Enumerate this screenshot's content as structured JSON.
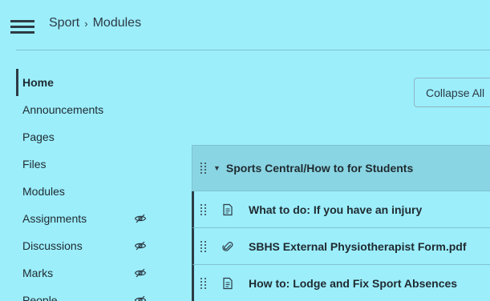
{
  "header": {
    "course": "Sport",
    "separator": "›",
    "page": "Modules"
  },
  "sidebar": {
    "items": [
      {
        "label": "Home",
        "active": true,
        "hidden_icon": false
      },
      {
        "label": "Announcements",
        "active": false,
        "hidden_icon": false
      },
      {
        "label": "Pages",
        "active": false,
        "hidden_icon": false
      },
      {
        "label": "Files",
        "active": false,
        "hidden_icon": false
      },
      {
        "label": "Modules",
        "active": false,
        "hidden_icon": false
      },
      {
        "label": "Assignments",
        "active": false,
        "hidden_icon": true
      },
      {
        "label": "Discussions",
        "active": false,
        "hidden_icon": true
      },
      {
        "label": "Marks",
        "active": false,
        "hidden_icon": true
      },
      {
        "label": "People",
        "active": false,
        "hidden_icon": true
      }
    ],
    "hidden_icon_name": "eye-slash-icon"
  },
  "toolbar": {
    "collapse_label": "Collapse All"
  },
  "module": {
    "title": "Sports Central/How to for Students",
    "items": [
      {
        "title": "What to do: If you have an injury",
        "icon": "page-icon"
      },
      {
        "title": "SBHS External Physiotherapist Form.pdf",
        "icon": "attachment-icon"
      },
      {
        "title": "How to: Lodge and Fix Sport Absences",
        "icon": "page-icon"
      }
    ]
  },
  "colors": {
    "background": "#9ceefb",
    "module_header": "#8ad5e3",
    "text": "#1f2a30",
    "accent_border": "#2d3b45"
  }
}
